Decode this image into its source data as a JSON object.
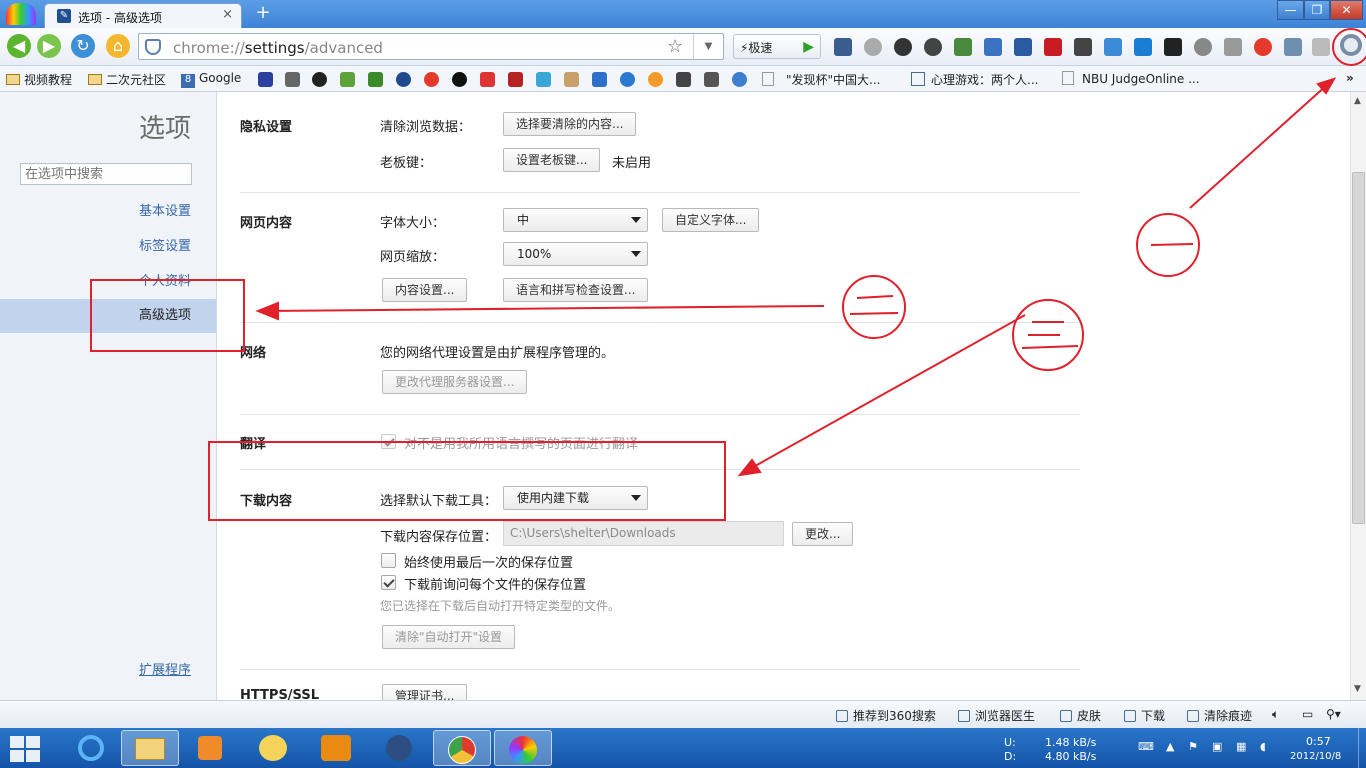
{
  "tab": {
    "title": "选项 - 高级选项",
    "close": "×",
    "new_tab": "+"
  },
  "window_controls": {
    "minimize": "—",
    "restore": "❐",
    "close": "✕"
  },
  "address": {
    "scheme": "chrome://",
    "host": "settings",
    "path": "/advanced"
  },
  "speed_button": "⚡极速",
  "bookmarks": {
    "items": [
      "视频教程",
      "二次元社区",
      "Google",
      "\"发现杯\"中国大...",
      "心理游戏：两个人...",
      "NBU JudgeOnline ..."
    ]
  },
  "sidebar": {
    "title": "选项",
    "search_placeholder": "在选项中搜索",
    "items": [
      "基本设置",
      "标签设置",
      "个人资料",
      "高级选项"
    ],
    "extensions": "扩展程序"
  },
  "privacy": {
    "heading": "隐私设置",
    "clear_label": "清除浏览数据：",
    "clear_button": "选择要清除的内容...",
    "boss_label": "老板键：",
    "boss_button": "设置老板键...",
    "boss_status": "未启用"
  },
  "webcontent": {
    "heading": "网页内容",
    "font_label": "字体大小：",
    "font_value": "中",
    "custom_font_button": "自定义字体...",
    "zoom_label": "网页缩放：",
    "zoom_value": "100%",
    "content_settings_button": "内容设置...",
    "language_button": "语言和拼写检查设置..."
  },
  "network": {
    "heading": "网络",
    "text": "您的网络代理设置是由扩展程序管理的。",
    "proxy_button": "更改代理服务器设置..."
  },
  "translate": {
    "heading": "翻译",
    "label": "对不是用我所用语言撰写的页面进行翻译",
    "checked": true
  },
  "downloads": {
    "heading": "下载内容",
    "tool_label": "选择默认下载工具：",
    "tool_value": "使用内建下载",
    "location_label": "下载内容保存位置：",
    "location_value": "C:\\Users\\shelter\\Downloads",
    "change_button": "更改...",
    "always_last_label": "始终使用最后一次的保存位置",
    "always_last_checked": false,
    "ask_each_label": "下载前询问每个文件的保存位置",
    "ask_each_checked": true,
    "auto_open_note": "您已选择在下载后自动打开特定类型的文件。",
    "clear_auto_open_button": "清除\"自动打开\"设置"
  },
  "https": {
    "heading": "HTTPS/SSL",
    "manage_certs_button": "管理证书..."
  },
  "statusbar": {
    "items": [
      "推荐到360搜索",
      "浏览器医生",
      "皮肤",
      "下载",
      "清除痕迹"
    ]
  },
  "tray": {
    "up_label": "U:",
    "down_label": "D:",
    "up_speed": "1.48 kB/s",
    "down_speed": "4.80 kB/s",
    "time": "0:57",
    "date": "2012/10/8"
  },
  "colors": {
    "annotation": "#e0202a",
    "selected_nav": "#c1d3ed",
    "link": "#3567a9",
    "taskbar": "#1a5fb4"
  }
}
